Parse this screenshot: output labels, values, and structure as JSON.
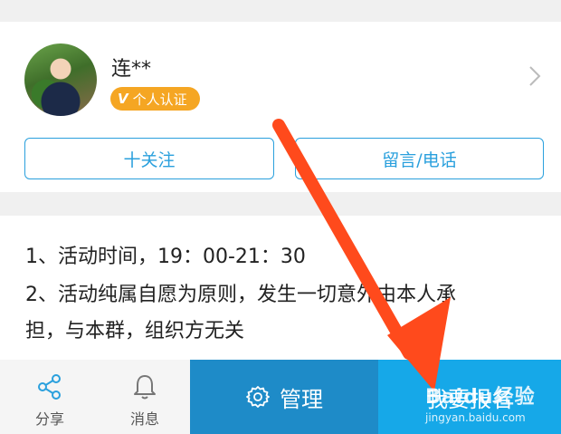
{
  "profile": {
    "name": "连**",
    "badge_mark": "V",
    "badge_text": "个人认证"
  },
  "actions": {
    "follow_label": "十关注",
    "message_label": "留言/电话"
  },
  "description": {
    "line1": "1、活动时间，19：00-21：30",
    "line2": "2、活动纯属自愿为原则，发生一切意外由本人承",
    "line3": "担，与本群，组织方无关"
  },
  "bottom_bar": {
    "share_label": "分享",
    "messages_label": "消息",
    "manage_label": "管理",
    "signup_label": "我要报名"
  },
  "watermark": {
    "logo": "Baidu经验",
    "url": "jingyan.baidu.com"
  },
  "colors": {
    "accent_blue": "#2aa0dd",
    "manage_bg": "#1e8bc8",
    "signup_bg": "#16a8e8",
    "badge_orange": "#f5a623",
    "arrow_red": "#ff4a1c"
  },
  "icons": {
    "share": "share-icon",
    "messages": "bell-icon",
    "manage": "gear-icon",
    "chevron": "chevron-right-icon"
  }
}
